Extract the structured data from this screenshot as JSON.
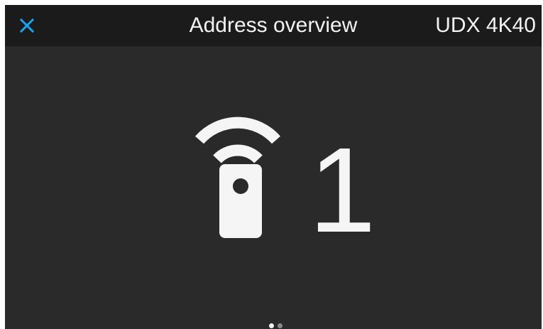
{
  "header": {
    "close_icon": "close-icon",
    "title": "Address overview",
    "device_name": "UDX 4K40"
  },
  "main": {
    "icon": "remote-control-wireless-icon",
    "address_value": "1"
  },
  "pager": {
    "total_pages": 2,
    "active_page": 1
  },
  "colors": {
    "accent": "#1aa3f0",
    "background": "#2a2a2a",
    "header_background": "#1b1b1b",
    "text": "#f2f2f2"
  }
}
